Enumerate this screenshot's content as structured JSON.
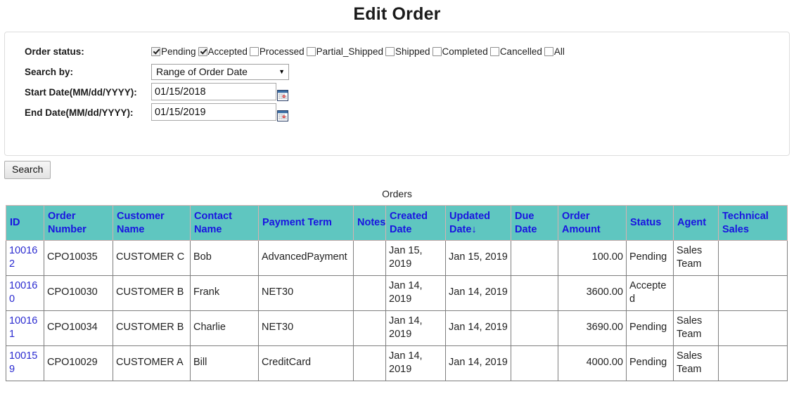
{
  "page": {
    "title": "Edit Order"
  },
  "search_panel": {
    "status_label": "Order status:",
    "status_options": [
      {
        "label": "Pending",
        "checked": true
      },
      {
        "label": "Accepted",
        "checked": true
      },
      {
        "label": "Processed",
        "checked": false
      },
      {
        "label": "Partial_Shipped",
        "checked": false
      },
      {
        "label": "Shipped",
        "checked": false
      },
      {
        "label": "Completed",
        "checked": false
      },
      {
        "label": "Cancelled",
        "checked": false
      },
      {
        "label": "All",
        "checked": false
      }
    ],
    "search_by_label": "Search by:",
    "search_by_value": "Range of Order Date",
    "search_by_options": [
      "Range of Order Date"
    ],
    "start_date_label": "Start Date(MM/dd/YYYY):",
    "start_date_value": "01/15/2018",
    "end_date_label": "End Date(MM/dd/YYYY):",
    "end_date_value": "01/15/2019",
    "calendar_icon": "calendar-icon",
    "search_button_label": "Search"
  },
  "table": {
    "caption": "Orders",
    "sort_indicator": "↓",
    "headers": [
      "ID",
      "Order Number",
      "Customer Name",
      "Contact Name",
      "Payment Term",
      "Notes",
      "Created Date",
      "Updated Date↓",
      "Due Date",
      "Order Amount",
      "Status",
      "Agent",
      "Technical Sales"
    ],
    "rows": [
      {
        "id": "100162",
        "order_number": "CPO10035",
        "customer_name": "CUSTOMER C",
        "contact_name": "Bob",
        "payment_term": "AdvancedPayment",
        "notes": "",
        "created_date": "Jan 15, 2019",
        "updated_date": "Jan 15, 2019",
        "due_date": "",
        "order_amount": "100.00",
        "status": "Pending",
        "agent": "Sales Team",
        "technical_sales": ""
      },
      {
        "id": "100160",
        "order_number": "CPO10030",
        "customer_name": "CUSTOMER B",
        "contact_name": "Frank",
        "payment_term": "NET30",
        "notes": "",
        "created_date": "Jan 14, 2019",
        "updated_date": "Jan 14, 2019",
        "due_date": "",
        "order_amount": "3600.00",
        "status": "Accepted",
        "agent": "",
        "technical_sales": ""
      },
      {
        "id": "100161",
        "order_number": "CPO10034",
        "customer_name": "CUSTOMER B",
        "contact_name": "Charlie",
        "payment_term": "NET30",
        "notes": "",
        "created_date": "Jan 14, 2019",
        "updated_date": "Jan 14, 2019",
        "due_date": "",
        "order_amount": "3690.00",
        "status": "Pending",
        "agent": "Sales Team",
        "technical_sales": ""
      },
      {
        "id": "100159",
        "order_number": "CPO10029",
        "customer_name": "CUSTOMER A",
        "contact_name": "Bill",
        "payment_term": "CreditCard",
        "notes": "",
        "created_date": "Jan 14, 2019",
        "updated_date": "Jan 14, 2019",
        "due_date": "",
        "order_amount": "4000.00",
        "status": "Pending",
        "agent": "Sales Team",
        "technical_sales": ""
      }
    ]
  },
  "colors": {
    "header_bg": "#5fc6c0",
    "header_text": "#1a14e0",
    "link": "#2a2ad0",
    "panel_border": "#dddddd"
  }
}
